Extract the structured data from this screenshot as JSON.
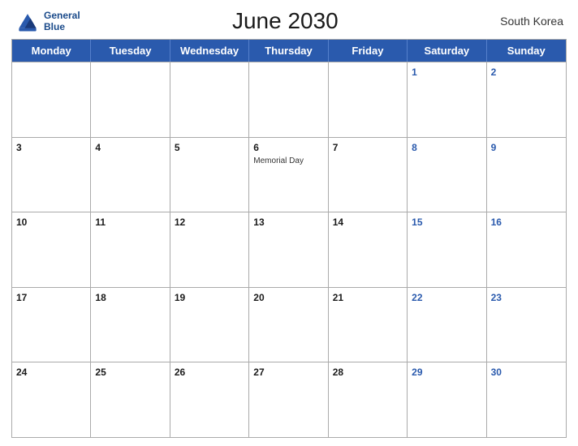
{
  "header": {
    "logo_line1": "General",
    "logo_line2": "Blue",
    "title": "June 2030",
    "country": "South Korea"
  },
  "day_headers": [
    "Monday",
    "Tuesday",
    "Wednesday",
    "Thursday",
    "Friday",
    "Saturday",
    "Sunday"
  ],
  "weeks": [
    [
      {
        "num": "",
        "empty": true,
        "weekend": false
      },
      {
        "num": "",
        "empty": true,
        "weekend": false
      },
      {
        "num": "",
        "empty": true,
        "weekend": false
      },
      {
        "num": "",
        "empty": true,
        "weekend": false
      },
      {
        "num": "",
        "empty": true,
        "weekend": false
      },
      {
        "num": "1",
        "empty": false,
        "weekend": true
      },
      {
        "num": "2",
        "empty": false,
        "weekend": true
      }
    ],
    [
      {
        "num": "3",
        "empty": false,
        "weekend": false
      },
      {
        "num": "4",
        "empty": false,
        "weekend": false
      },
      {
        "num": "5",
        "empty": false,
        "weekend": false
      },
      {
        "num": "6",
        "empty": false,
        "weekend": false,
        "event": "Memorial Day"
      },
      {
        "num": "7",
        "empty": false,
        "weekend": false
      },
      {
        "num": "8",
        "empty": false,
        "weekend": true
      },
      {
        "num": "9",
        "empty": false,
        "weekend": true
      }
    ],
    [
      {
        "num": "10",
        "empty": false,
        "weekend": false
      },
      {
        "num": "11",
        "empty": false,
        "weekend": false
      },
      {
        "num": "12",
        "empty": false,
        "weekend": false
      },
      {
        "num": "13",
        "empty": false,
        "weekend": false
      },
      {
        "num": "14",
        "empty": false,
        "weekend": false
      },
      {
        "num": "15",
        "empty": false,
        "weekend": true
      },
      {
        "num": "16",
        "empty": false,
        "weekend": true
      }
    ],
    [
      {
        "num": "17",
        "empty": false,
        "weekend": false
      },
      {
        "num": "18",
        "empty": false,
        "weekend": false
      },
      {
        "num": "19",
        "empty": false,
        "weekend": false
      },
      {
        "num": "20",
        "empty": false,
        "weekend": false
      },
      {
        "num": "21",
        "empty": false,
        "weekend": false
      },
      {
        "num": "22",
        "empty": false,
        "weekend": true
      },
      {
        "num": "23",
        "empty": false,
        "weekend": true
      }
    ],
    [
      {
        "num": "24",
        "empty": false,
        "weekend": false
      },
      {
        "num": "25",
        "empty": false,
        "weekend": false
      },
      {
        "num": "26",
        "empty": false,
        "weekend": false
      },
      {
        "num": "27",
        "empty": false,
        "weekend": false
      },
      {
        "num": "28",
        "empty": false,
        "weekend": false
      },
      {
        "num": "29",
        "empty": false,
        "weekend": true
      },
      {
        "num": "30",
        "empty": false,
        "weekend": true
      }
    ]
  ]
}
